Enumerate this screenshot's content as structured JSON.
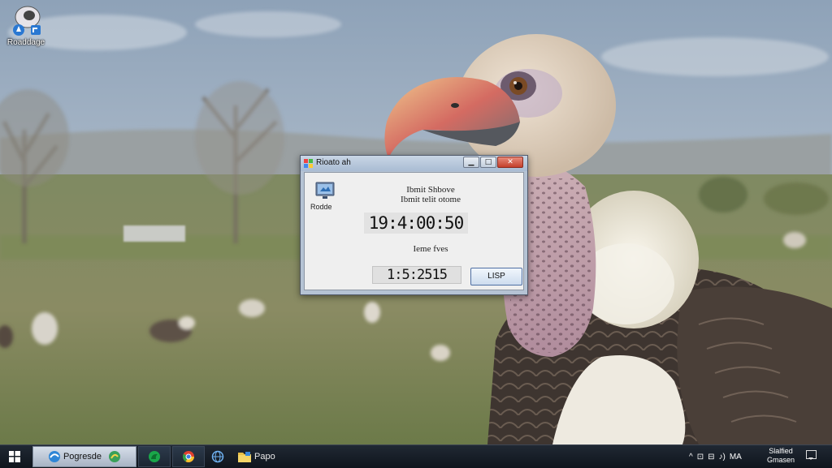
{
  "desktop": {
    "icons": [
      {
        "label": "Roaddage",
        "icon": "app-shortcut-icon"
      }
    ]
  },
  "dialog": {
    "title": "Rioato ah",
    "buttons": {
      "minimize": "▁",
      "maximize": "□",
      "close": "✕"
    },
    "icon_caption": "Rodde",
    "heading_line1": "Ibmit Shbove",
    "heading_line2": "Ibmit telit otome",
    "main_time": "19:4:00:50",
    "sub_label": "Ieme fves",
    "secondary_time": "1:5:2515",
    "action_button": "LISP"
  },
  "taskbar": {
    "start_icon": "windows-logo-icon",
    "items": [
      {
        "label": "Pogresde",
        "icon": "browser-icon",
        "active": true
      },
      {
        "label": "",
        "icon": "edge-icon",
        "active": false
      },
      {
        "label": "",
        "icon": "chrome-icon",
        "active": false
      },
      {
        "label": "",
        "icon": "globe-icon",
        "active": false
      },
      {
        "label": "Papo",
        "icon": "folder-icon",
        "active": false
      }
    ],
    "tray": [
      "^",
      "⊡",
      "⊟",
      "♪)",
      "MA"
    ],
    "clock_line1": "Slalfied",
    "clock_line2": "Gmasen"
  },
  "colors": {
    "sky": "#9fb0c3",
    "field": "#7b8559",
    "titlebar": "#b5c3d4",
    "close_button": "#c4402c",
    "taskbar": "#151b24"
  }
}
